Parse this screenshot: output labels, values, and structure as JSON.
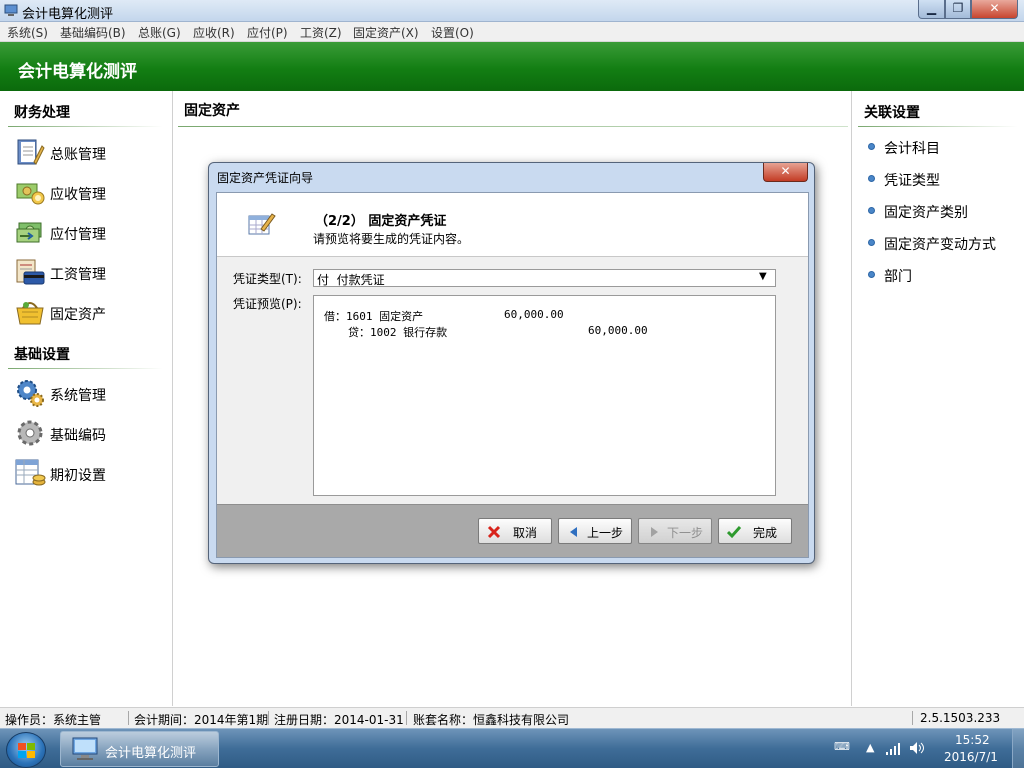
{
  "window": {
    "title": "会计电算化测评",
    "min": "▁",
    "max": "❐",
    "close": "✕"
  },
  "menu": [
    "系统(S)",
    "基础编码(B)",
    "总账(G)",
    "应收(R)",
    "应付(P)",
    "工资(Z)",
    "固定资产(X)",
    "设置(O)"
  ],
  "banner": {
    "title": "会计电算化测评"
  },
  "left": {
    "section1": "财务处理",
    "items1": [
      "总账管理",
      "应收管理",
      "应付管理",
      "工资管理",
      "固定资产"
    ],
    "section2": "基础设置",
    "items2": [
      "系统管理",
      "基础编码",
      "期初设置"
    ]
  },
  "center": {
    "title": "固定资产"
  },
  "right": {
    "section": "关联设置",
    "links": [
      "会计科目",
      "凭证类型",
      "固定资产类别",
      "固定资产变动方式",
      "部门"
    ]
  },
  "dialog": {
    "title": "固定资产凭证向导",
    "close": "✕",
    "step_title": "（2/2） 固定资产凭证",
    "step_desc": "请预览将要生成的凭证内容。",
    "type_label": "凭证类型(T):",
    "type_value": "付  付款凭证",
    "preview_label": "凭证预览(P):",
    "preview": {
      "line1_label": "借：1601 固定资产",
      "line1_amount": "60,000.00",
      "line2_label": "贷：1002 银行存款",
      "line2_amount": "60,000.00"
    },
    "buttons": {
      "cancel": "取消",
      "prev": "上一步",
      "next": "下一步",
      "finish": "完成"
    }
  },
  "status": {
    "operator": "操作员：系统主管",
    "period": "会计期间：2014年第1期",
    "reg_date": "注册日期：2014-01-31",
    "account": "账套名称：恒鑫科技有限公司",
    "version": "2.5.1503.233"
  },
  "taskbar": {
    "item": "会计电算化测评",
    "time": "15:52",
    "date": "2016/7/1"
  },
  "colors": {
    "banner_green": "#137e13",
    "link_dot": "#4a86c8",
    "taskbar_blue": "#3f6d98"
  }
}
